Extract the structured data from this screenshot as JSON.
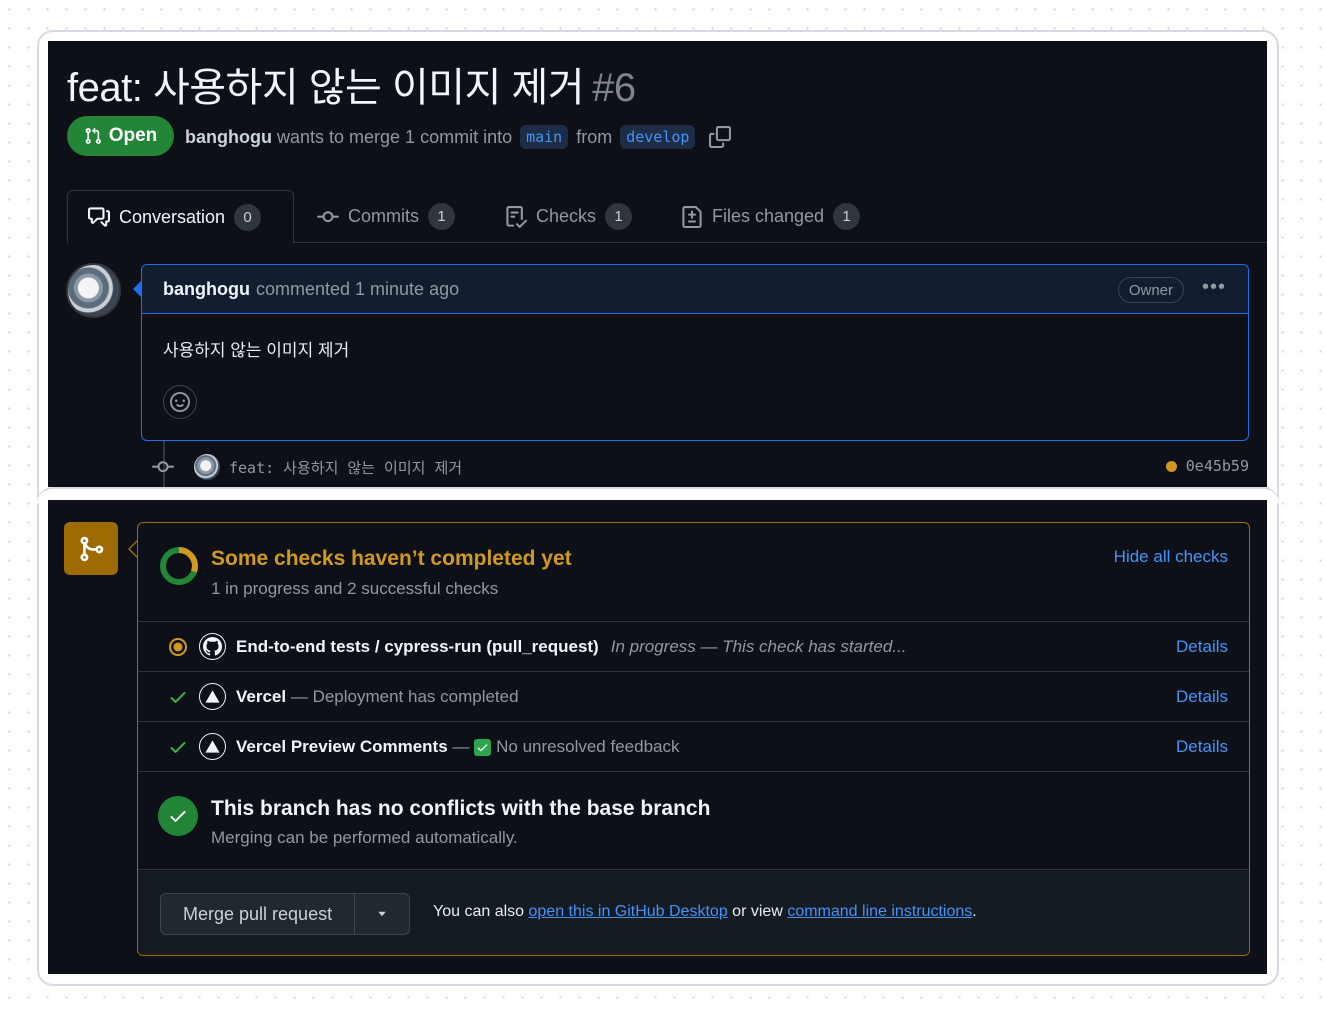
{
  "pr": {
    "title": "feat: 사용하지 않는 이미지 제거",
    "number": "#6",
    "state": "Open",
    "author": "banghogu",
    "merge_text": "wants to merge 1 commit into",
    "base_branch": "main",
    "from_text": "from",
    "head_branch": "develop"
  },
  "tabs": [
    {
      "label": "Conversation",
      "count": "0",
      "icon": "comment-discussion-icon"
    },
    {
      "label": "Commits",
      "count": "1",
      "icon": "git-commit-icon"
    },
    {
      "label": "Checks",
      "count": "1",
      "icon": "checklist-icon"
    },
    {
      "label": "Files changed",
      "count": "1",
      "icon": "file-diff-icon"
    }
  ],
  "comment": {
    "author": "banghogu",
    "action": "commented 1 minute ago",
    "role": "Owner",
    "body": "사용하지 않는 이미지 제거"
  },
  "commit": {
    "message": "feat: 사용하지 않는 이미지 제거",
    "sha": "0e45b59"
  },
  "checks": {
    "title": "Some checks haven’t completed yet",
    "subtitle": "1 in progress and 2 successful checks",
    "toggle_label": "Hide all checks",
    "items": [
      {
        "name": "End-to-end tests / cypress-run (pull_request)",
        "description": "In progress — This check has started...",
        "status": "in-progress",
        "details": "Details"
      },
      {
        "name": "Vercel",
        "description": "— Deployment has completed",
        "status": "success",
        "details": "Details"
      },
      {
        "name": "Vercel Preview Comments",
        "separator": "—",
        "description": "No unresolved feedback",
        "status": "success",
        "details": "Details"
      }
    ]
  },
  "conflicts": {
    "title": "This branch has no conflicts with the base branch",
    "subtitle": "Merging can be performed automatically."
  },
  "merge": {
    "button_label": "Merge pull request",
    "note_prefix": "You can also",
    "desktop_link": "open this in GitHub Desktop",
    "note_middle": "or view",
    "cli_link": "command line instructions",
    "note_suffix": "."
  },
  "colors": {
    "open_green": "#238636",
    "pending_yellow": "#d29922",
    "link_blue": "#4493f8",
    "background": "#0d1117"
  }
}
